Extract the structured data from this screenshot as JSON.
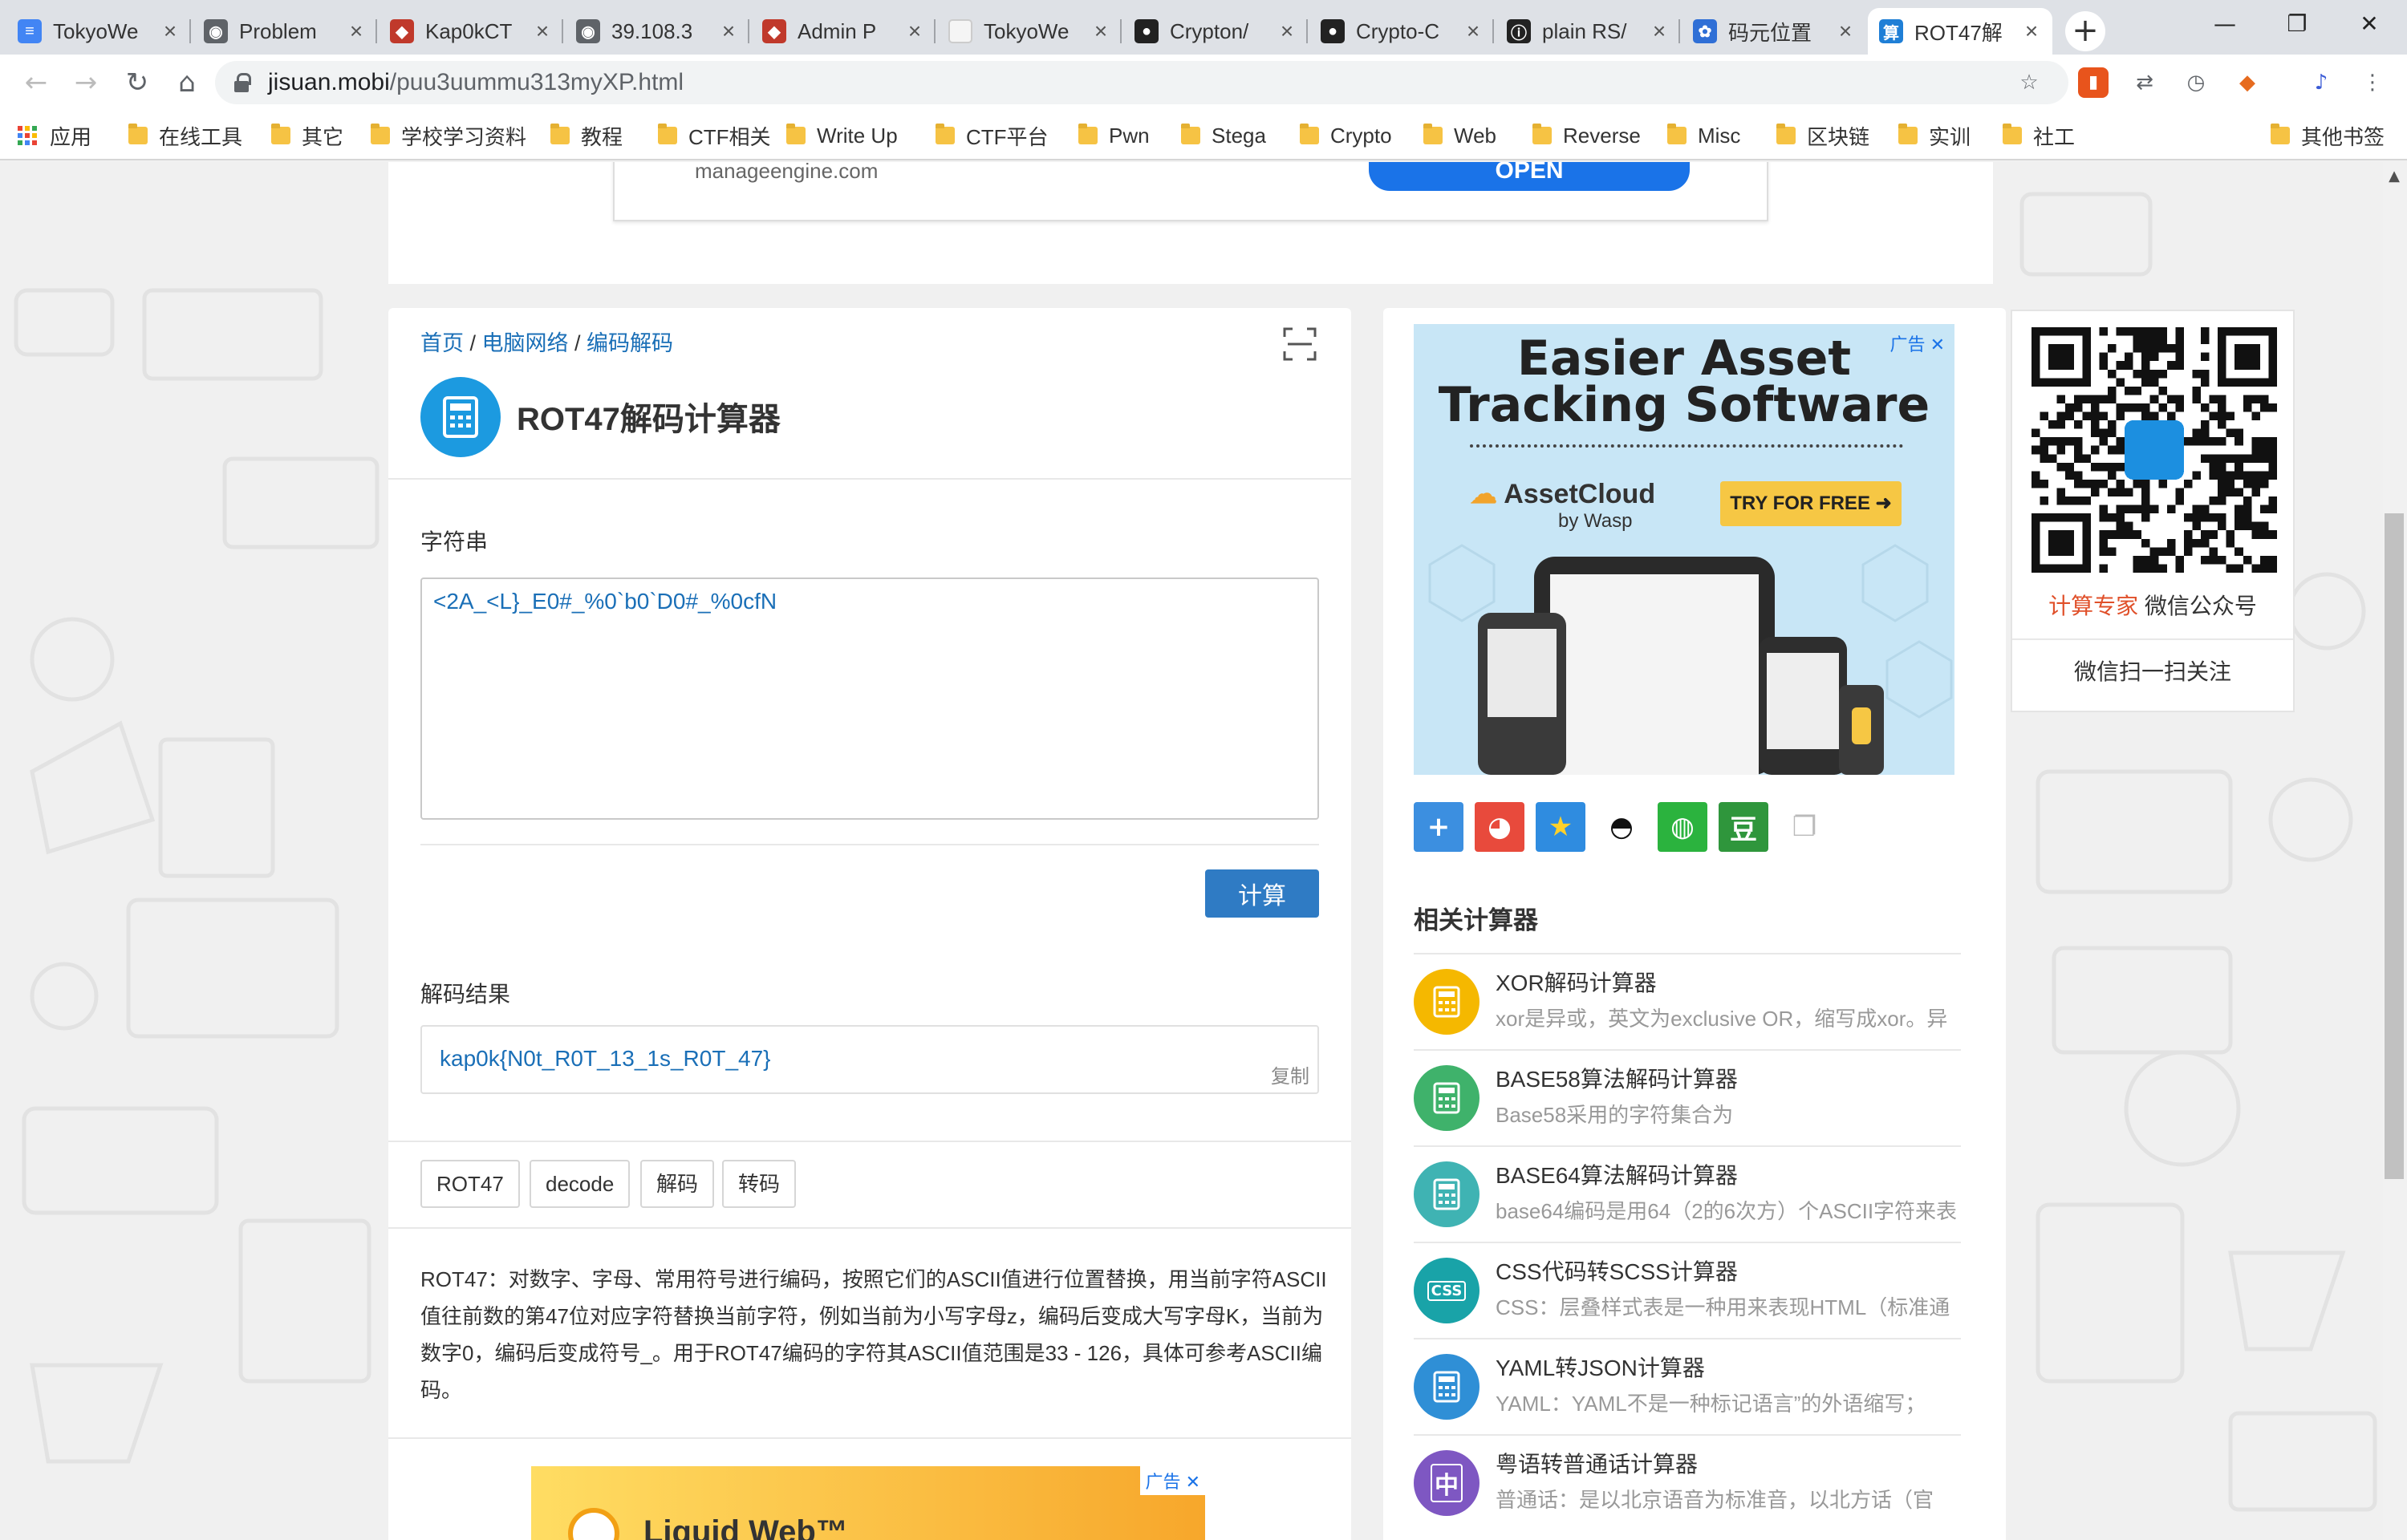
{
  "browser": {
    "tabs": [
      {
        "title": "TokyoWe",
        "icon": "docs-icon",
        "color": "#4285f4"
      },
      {
        "title": "Problem",
        "icon": "globe-icon",
        "color": "#5f6368"
      },
      {
        "title": "Kap0kCT",
        "icon": "ctf-icon",
        "color": "#c0392b"
      },
      {
        "title": "39.108.3",
        "icon": "globe-icon",
        "color": "#5f6368"
      },
      {
        "title": "Admin P",
        "icon": "ctf-icon",
        "color": "#c0392b"
      },
      {
        "title": "TokyoWe",
        "icon": "page-icon",
        "color": "#f5f5f5"
      },
      {
        "title": "Crypton/",
        "icon": "github-icon",
        "color": "#222"
      },
      {
        "title": "Crypto-C",
        "icon": "github-icon",
        "color": "#222"
      },
      {
        "title": "plain RS/",
        "icon": "info-icon",
        "color": "#222"
      },
      {
        "title": "码元位置",
        "icon": "paw-icon",
        "color": "#2f6fd6"
      },
      {
        "title": "ROT47解",
        "icon": "calc-tab-icon",
        "color": "#1f7fd6"
      }
    ],
    "tab_icon_glyphs": {
      "docs-icon": "≡",
      "globe-icon": "◉",
      "ctf-icon": "◆",
      "page-icon": "",
      "github-icon": "●",
      "info-icon": "ⓘ",
      "paw-icon": "✿",
      "calc-tab-icon": "算"
    },
    "url_host": "jisuan.mobi",
    "url_path": "/puu3uummu313myXP.html",
    "bookmarks": [
      "应用",
      "在线工具",
      "其它",
      "学校学习资料",
      "教程",
      "CTF相关",
      "Write Up",
      "CTF平台",
      "Pwn",
      "Stega",
      "Crypto",
      "Web",
      "Reverse",
      "Misc",
      "区块链",
      "实训",
      "社工"
    ],
    "other_bookmarks": "其他书签"
  },
  "top_ad": {
    "domain": "manageengine.com",
    "button": "OPEN"
  },
  "main": {
    "breadcrumb": [
      "首页",
      "电脑网络",
      "编码解码"
    ],
    "breadcrumb_sep": " / ",
    "title": "ROT47解码计算器",
    "input_label": "字符串",
    "input_value": "<2A_<L}_E0#_%0`b0`D0#_%0cfN",
    "calc_button": "计算",
    "result_label": "解码结果",
    "result_value": "kap0k{N0t_R0T_13_1s_R0T_47}",
    "copy_label": "复制",
    "tags": [
      "ROT47",
      "decode",
      "解码",
      "转码"
    ],
    "description": "ROT47：对数字、字母、常用符号进行编码，按照它们的ASCII值进行位置替换，用当前字符ASCII值往前数的第47位对应字符替换当前字符，例如当前为小写字母z，编码后变成大写字母K，当前为数字0，编码后变成符号_。用于ROT47编码的字符其ASCII值范围是33 - 126，具体可参考ASCII编码。",
    "bottom_ad_badge": "广告",
    "bottom_ad_brand": "Liquid Web™"
  },
  "side": {
    "ad_badge": "广告",
    "ad_headline_1": "Easier Asset",
    "ad_headline_2": "Tracking Software",
    "ad_brand": "AssetCloud",
    "ad_brand_sub": "by Wasp",
    "ad_cta": "TRY FOR FREE",
    "share_icons": [
      "plus-share-icon",
      "weibo-icon",
      "qzone-icon",
      "qq-icon",
      "wechat-icon",
      "douban-icon",
      "copy-icon"
    ],
    "related_title": "相关计算器",
    "related": [
      {
        "name": "XOR解码计算器",
        "desc": "xor是异或，英文为exclusive OR，缩写成xor。异",
        "color": "#f5b800"
      },
      {
        "name": "BASE58算法解码计算器",
        "desc": "Base58采用的字符集合为",
        "color": "#3fb26b"
      },
      {
        "name": "BASE64算法解码计算器",
        "desc": "base64编码是用64（2的6次方）个ASCII字符来表",
        "color": "#3fb3b3"
      },
      {
        "name": "CSS代码转SCSS计算器",
        "desc": "CSS：层叠样式表是一种用来表现HTML（标准通",
        "color": "#19a3a8",
        "icon_text": "CSS"
      },
      {
        "name": "YAML转JSON计算器",
        "desc": "YAML：YAML不是一种标记语言”的外语缩写；",
        "color": "#2f8fd6"
      },
      {
        "name": "粤语转普通话计算器",
        "desc": "普通话：是以北京语音为标准音，以北方话（官",
        "color": "#7e57c2",
        "icon_text": "中"
      }
    ]
  },
  "qr": {
    "brand": "计算专家",
    "caption_rest": " 微信公众号",
    "follow": "微信扫一扫关注",
    "logo_text": "计算专家"
  }
}
